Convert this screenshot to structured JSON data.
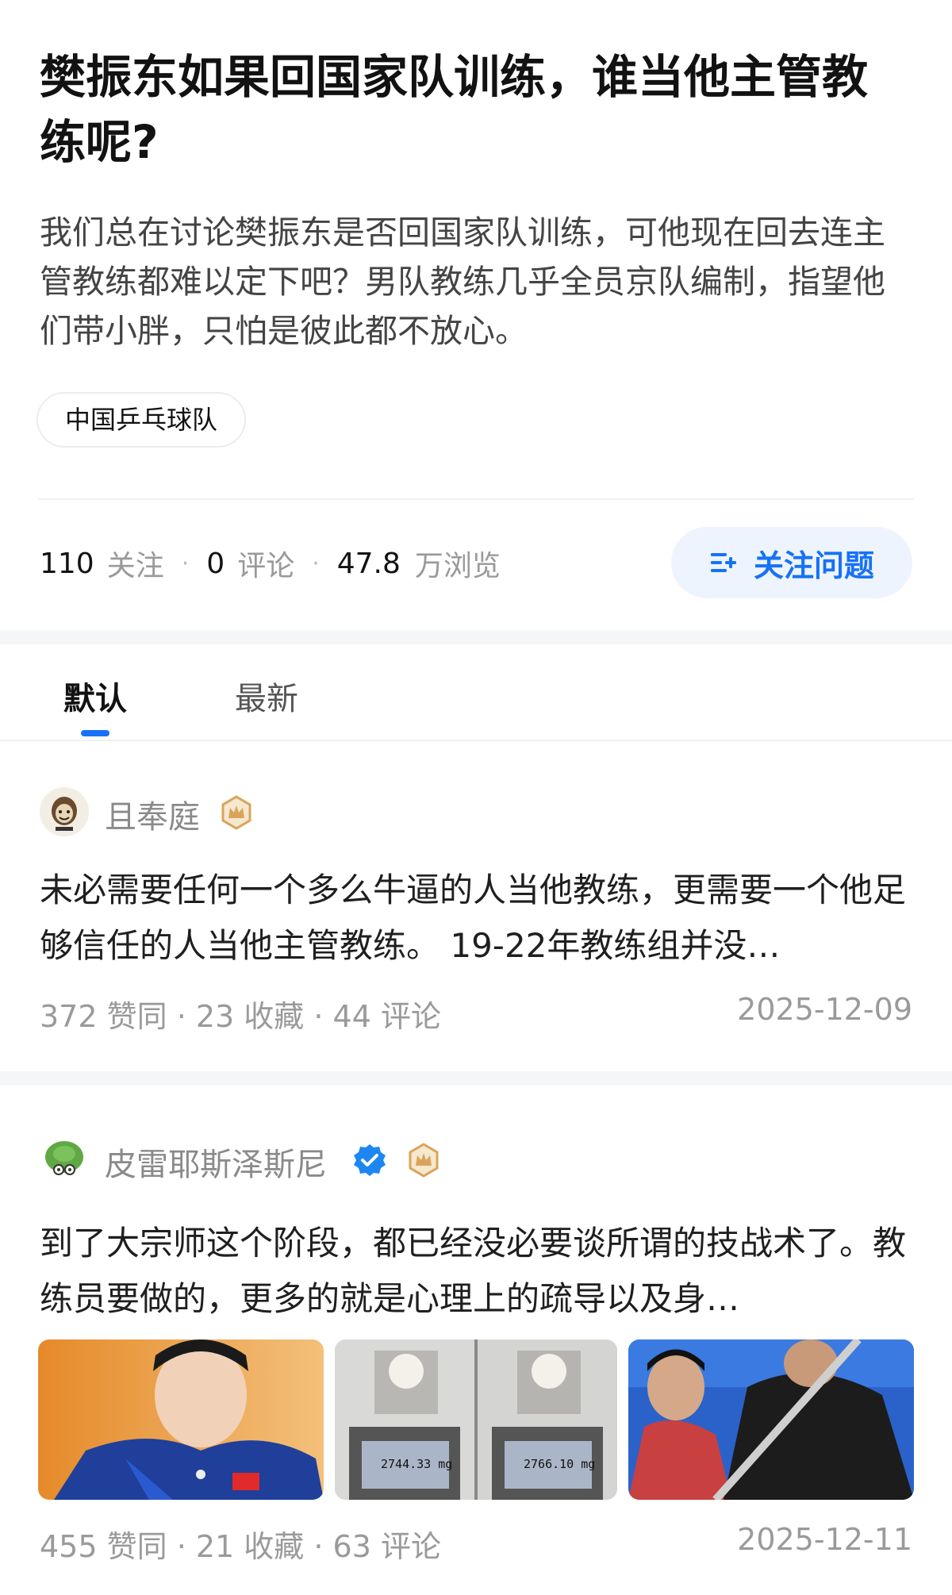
{
  "question": {
    "title": "樊振东如果回国家队训练，谁当他主管教练呢?",
    "description": "我们总在讨论樊振东是否回国家队训练，可他现在回去连主管教练都难以定下吧？男队教练几乎全员京队编制，指望他们带小胖，只怕是彼此都不放心。",
    "topic": "中国乒乓球队"
  },
  "stats": {
    "follow_count": "110",
    "follow_label": "关注",
    "comment_count": "0",
    "comment_label": "评论",
    "view_count": "47.8",
    "view_label": "万浏览",
    "follow_button": "关注问题"
  },
  "tabs": {
    "default": "默认",
    "latest": "最新"
  },
  "answers": [
    {
      "author": "且奉庭",
      "excerpt": "未必需要任何一个多么牛逼的人当他教练，更需要一个他足够信任的人当他主管教练。 19-22年教练组并没…",
      "meta": "372 赞同 · 23 收藏 · 44 评论",
      "date": "2025-12-09"
    },
    {
      "author": "皮雷耶斯泽斯尼",
      "excerpt": "到了大宗师这个阶段，都已经没必要谈所谓的技战术了。教练员要做的，更多的就是心理上的疏导以及身…",
      "meta": "455 赞同 · 21 收藏 · 63 评论",
      "date": "2025-12-11",
      "images": [
        {
          "readout": "2744.33 mg"
        },
        {
          "readout": "2766.10 mg"
        }
      ]
    }
  ],
  "colors": {
    "accent": "#1772f6",
    "accent_bg": "#eef4fe",
    "verified": "#1d86f0",
    "badge_gold": "#d9a45a"
  }
}
